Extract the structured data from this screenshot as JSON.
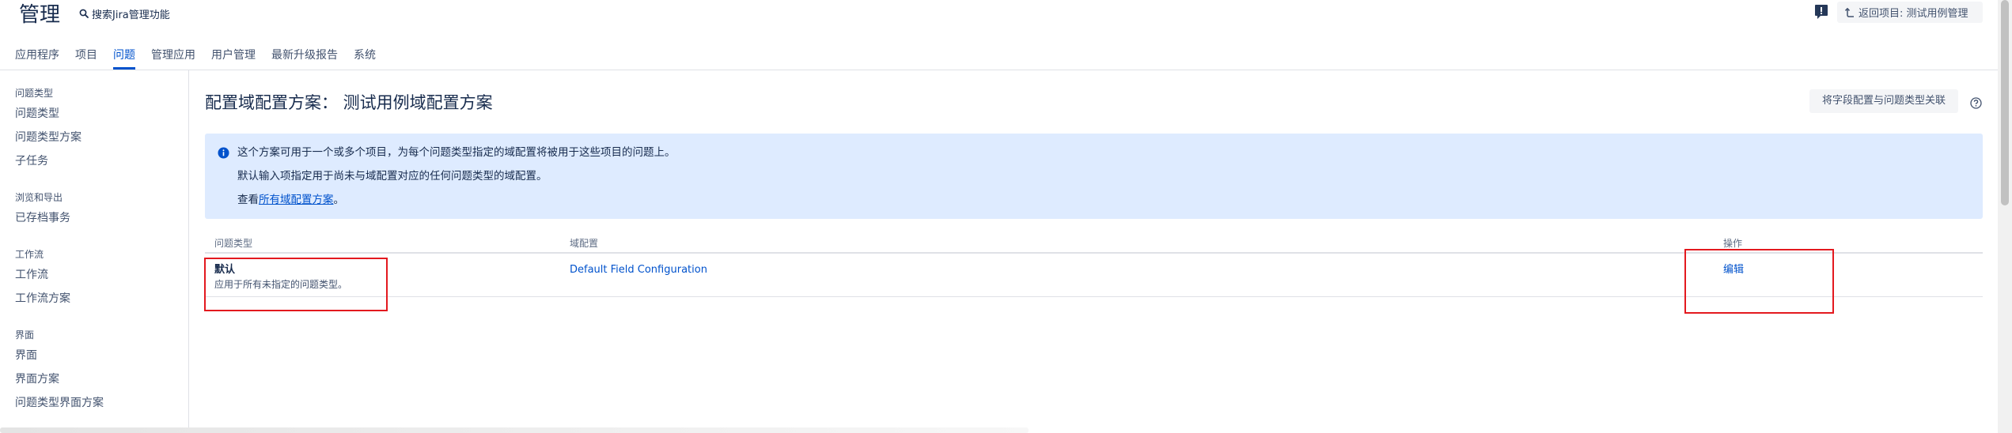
{
  "header": {
    "title": "管理",
    "search_label": "搜索Jira管理功能",
    "back_button": "返回项目: 测试用例管理"
  },
  "nav": {
    "tabs": [
      {
        "label": "应用程序",
        "active": false
      },
      {
        "label": "项目",
        "active": false
      },
      {
        "label": "问题",
        "active": true
      },
      {
        "label": "管理应用",
        "active": false
      },
      {
        "label": "用户管理",
        "active": false
      },
      {
        "label": "最新升级报告",
        "active": false
      },
      {
        "label": "系统",
        "active": false
      }
    ]
  },
  "sidebar": {
    "sections": [
      {
        "heading": "问题类型",
        "items": [
          "问题类型",
          "问题类型方案",
          "子任务"
        ]
      },
      {
        "heading": "浏览和导出",
        "items": [
          "已存档事务"
        ]
      },
      {
        "heading": "工作流",
        "items": [
          "工作流",
          "工作流方案"
        ]
      },
      {
        "heading": "界面",
        "items": [
          "界面",
          "界面方案",
          "问题类型界面方案"
        ]
      }
    ]
  },
  "main": {
    "title": "配置域配置方案： 测试用例域配置方案",
    "associate_button": "将字段配置与问题类型关联",
    "info": {
      "line1": "这个方案可用于一个或多个项目，为每个问题类型指定的域配置将被用于这些项目的问题上。",
      "line2": "默认输入项指定用于尚未与域配置对应的任何问题类型的域配置。",
      "line3_prefix": "查看",
      "line3_link": "所有域配置方案",
      "line3_suffix": "。"
    },
    "table": {
      "headers": [
        "问题类型",
        "域配置",
        "操作"
      ],
      "rows": [
        {
          "issue_type": "默认",
          "description": "应用于所有未指定的问题类型。",
          "field_config": "Default Field Configuration",
          "action": "编辑"
        }
      ]
    }
  },
  "icons": {
    "search": "search-icon",
    "feedback": "feedback-icon",
    "back": "back-arrow-icon",
    "help": "help-icon",
    "info": "info-icon"
  },
  "colors": {
    "text": "#172b4d",
    "link": "#0052cc",
    "info_background": "#deebff",
    "button_background": "#f4f5f7",
    "highlight_box": "#e3191f"
  }
}
